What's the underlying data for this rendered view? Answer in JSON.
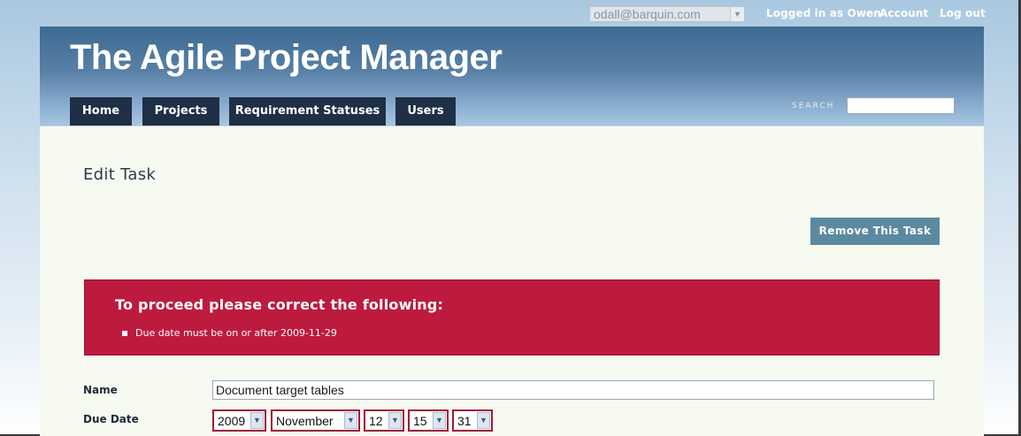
{
  "topbar": {
    "account_select_value": "odall@barquin.com",
    "logged_in_text": "Logged in as Owen",
    "account_link": "Account",
    "logout_link": "Log out"
  },
  "header": {
    "title": "The Agile Project Manager",
    "nav": [
      "Home",
      "Projects",
      "Requirement Statuses",
      "Users"
    ],
    "search_label": "SEARCH",
    "search_value": ""
  },
  "page": {
    "title": "Edit Task",
    "remove_button": "Remove This Task",
    "error": {
      "title": "To proceed please correct the following:",
      "items": [
        "Due date must be on or after 2009-11-29"
      ]
    },
    "form": {
      "name_label": "Name",
      "name_value": "Document target tables",
      "due_date_label": "Due Date",
      "due_date": {
        "year": "2009",
        "month": "November",
        "day": "12",
        "hour": "15",
        "minute": "31"
      }
    }
  },
  "colors": {
    "nav_tab_bg": "#1f2f45",
    "error_bg": "#bd1b3d",
    "button_bg": "#5b8aa0",
    "content_bg": "#f7faf0"
  }
}
